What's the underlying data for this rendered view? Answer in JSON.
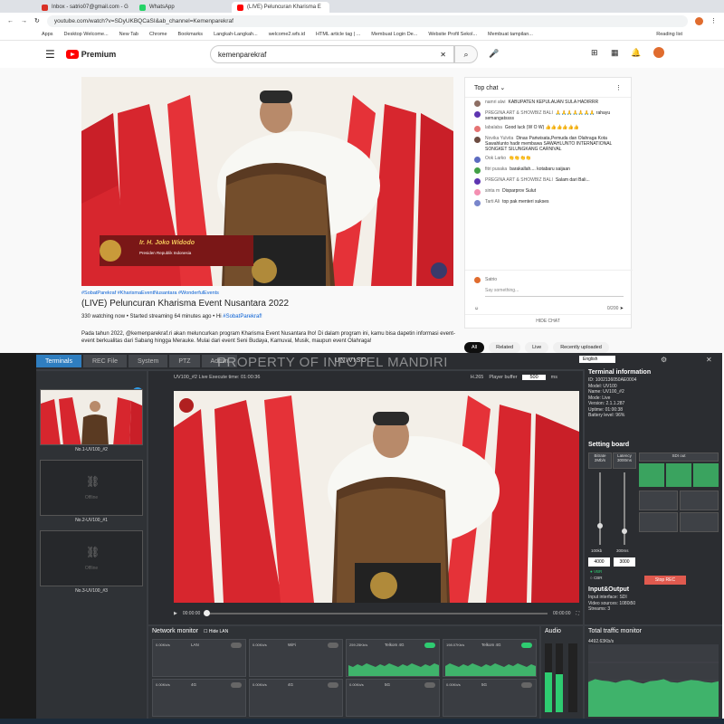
{
  "browser": {
    "tabs": [
      {
        "label": "Inbox - satrio07@gmail.com - G",
        "color": "#d93025"
      },
      {
        "label": "WhatsApp",
        "color": "#25d366"
      },
      {
        "label": "(LIVE) Peluncuran Kharisma E",
        "color": "#ff0000"
      }
    ],
    "url": "youtube.com/watch?v=SDyUKBQCaSI&ab_channel=Kemenparekraf",
    "bookmarks": [
      "Apps",
      "Desktop Welcome...",
      "New Tab",
      "Chrome",
      "Bookmarks",
      "Langkah-Langkah...",
      "welcome2.wfs.id",
      "HTML article tag | ...",
      "Membuat Login De...",
      "Website Profil Sekol...",
      "Membuat tampilan...",
      "Reading list"
    ]
  },
  "youtube": {
    "logo": "Premium",
    "search_value": "kemenparekraf",
    "video": {
      "lower_third_name": "Ir. H. Joko Widodo",
      "lower_third_role": "Presiden Republik Indonesia"
    },
    "tags": "#SobatParekraf #KharismaEventNusantara #WonderfulEvents",
    "title": "(LIVE) Peluncuran Kharisma Event Nusantara 2022",
    "stats": "330 watching now • Started streaming 64 minutes ago • Hi",
    "stats_tag": "#SobatParekraf!",
    "description": "Pada tahun 2022, @kemenparekraf.ri akan meluncurkan program Kharisma Event Nusantara lho! Di dalam program ini, kamu bisa dapetin informasi event-event berkualitas dari Sabang hingga Merauke. Mulai dari event Seni Budaya, Kamuval, Musik, maupun event Olahraga!",
    "chat": {
      "header": "Top chat",
      "messages": [
        {
          "author": "namri alwi",
          "text": "KABUPATEN KEPULAUAN SULA HADIRRR",
          "color": "#8d6e63"
        },
        {
          "author": "PREGINA ART & SHOWBIZ BALI",
          "text": "🙏🙏🙏🙏🙏🙏🙏 rahayu semangatssss",
          "color": "#5e35b1"
        },
        {
          "author": "labalaba",
          "text": "Good luck (W O W) 👍👍👍👍👍👍",
          "color": "#e57373"
        },
        {
          "author": "Novika Yulvita",
          "text": "Dinas Pariwisata,Pemuda dan Olahraga Kota Sawahlunto hadir membawa SAWAHLUNTO INTERNATIONAL SONGKET SILUNGKANG CARNIVAL",
          "color": "#6d4c41"
        },
        {
          "author": "Ook Larko",
          "text": "👏👏👏👏",
          "color": "#5c6bc0"
        },
        {
          "author": "fitri pusaka",
          "text": "barakallah.... kotabaru saijaan",
          "color": "#43a047"
        },
        {
          "author": "PREGINA ART & SHOWBIZ BALI",
          "text": "Salam dari Bali...",
          "color": "#5e35b1"
        },
        {
          "author": "sinta m",
          "text": "Disparprov Sulut",
          "color": "#f48fb1"
        },
        {
          "author": "Tarti Ali",
          "text": "top pak menteri sukses",
          "color": "#7986cb"
        }
      ],
      "input_user": "Satrio",
      "input_placeholder": "Say something...",
      "counter": "0/200",
      "hide": "HIDE CHAT"
    },
    "chips": [
      "All",
      "Related",
      "Live",
      "Recently uploaded"
    ]
  },
  "app": {
    "tabs": [
      "Terminals",
      "REC File",
      "System",
      "PTZ",
      "Admin"
    ],
    "watermark": "PROPERTY OF INFOTEL MANDIRI",
    "brand": "UNIVISO",
    "language": "English",
    "terminals": [
      {
        "label": "No.1-UV100_#2",
        "status": ""
      },
      {
        "label": "No.2-UV100_#1",
        "status": "Offline"
      },
      {
        "label": "No.3-UV100_#3",
        "status": "Offline"
      }
    ],
    "center_bar": "UV100_#2 Live  Execute time: 01:00:36",
    "codec": "H.265",
    "player_buffer_label": "Player buffer",
    "player_buffer_value": "500",
    "player_buffer_unit": "ms",
    "timeline_start": "00:00:00",
    "timeline_end": "00:00:00",
    "terminal_info": {
      "heading": "Terminal information",
      "lines": [
        "ID: 1002136050AE0004",
        "Model: UV100",
        "Name: UV100_#2",
        "Mode: Live",
        "Version: 2.1.1.287",
        "Uptime: 01:00:38",
        "Battery level: 96%"
      ]
    },
    "setting_board": {
      "heading": "Setting board",
      "bitrate_label": "Bitrate",
      "bitrate_value": "2Mb/s",
      "latency_label": "Latency",
      "latency_value": "3000ms",
      "sdi_out": "SDI out",
      "bitrate_min": "100kb",
      "latency_min": "300ms",
      "input_a": "4000",
      "input_b": "3000",
      "vbr": "VBR",
      "cbr": "CBR",
      "stop_rec": "Stop REC"
    },
    "io": {
      "heading": "Input&Output",
      "lines": [
        "Input interface: SDI",
        "Video sources: 1080i50",
        "Streams: 3"
      ]
    },
    "network_monitor": {
      "heading": "Network monitor",
      "hide_lan": "Hide LAN",
      "cells": [
        {
          "rate": "0.00Kb/s",
          "name": "LAN",
          "on": false
        },
        {
          "rate": "0.00Kb/s",
          "name": "WiFi",
          "on": false
        },
        {
          "rate": "259.25Kb/s",
          "name": "Telkom 4G",
          "on": true
        },
        {
          "rate": "198.07Kb/s",
          "name": "Telkom 4G",
          "on": true
        },
        {
          "rate": "0.00Kb/s",
          "name": "4G",
          "on": false
        },
        {
          "rate": "0.00Kb/s",
          "name": "4G",
          "on": false
        },
        {
          "rate": "0.00Kb/s",
          "name": "5G",
          "on": false
        },
        {
          "rate": "0.00Kb/s",
          "name": "5G",
          "on": false
        }
      ]
    },
    "audio_heading": "Audio",
    "traffic": {
      "heading": "Total traffic monitor",
      "rate": "4492.63Kb/s"
    }
  },
  "chart_data": {
    "type": "area",
    "title": "Total traffic monitor",
    "series": [
      {
        "values": [
          48,
          52,
          50,
          49,
          47,
          50,
          51,
          48,
          46,
          49,
          50,
          52,
          48,
          47,
          49,
          51,
          50,
          48,
          47,
          49
        ]
      }
    ],
    "ylim": [
      0,
      100
    ]
  }
}
